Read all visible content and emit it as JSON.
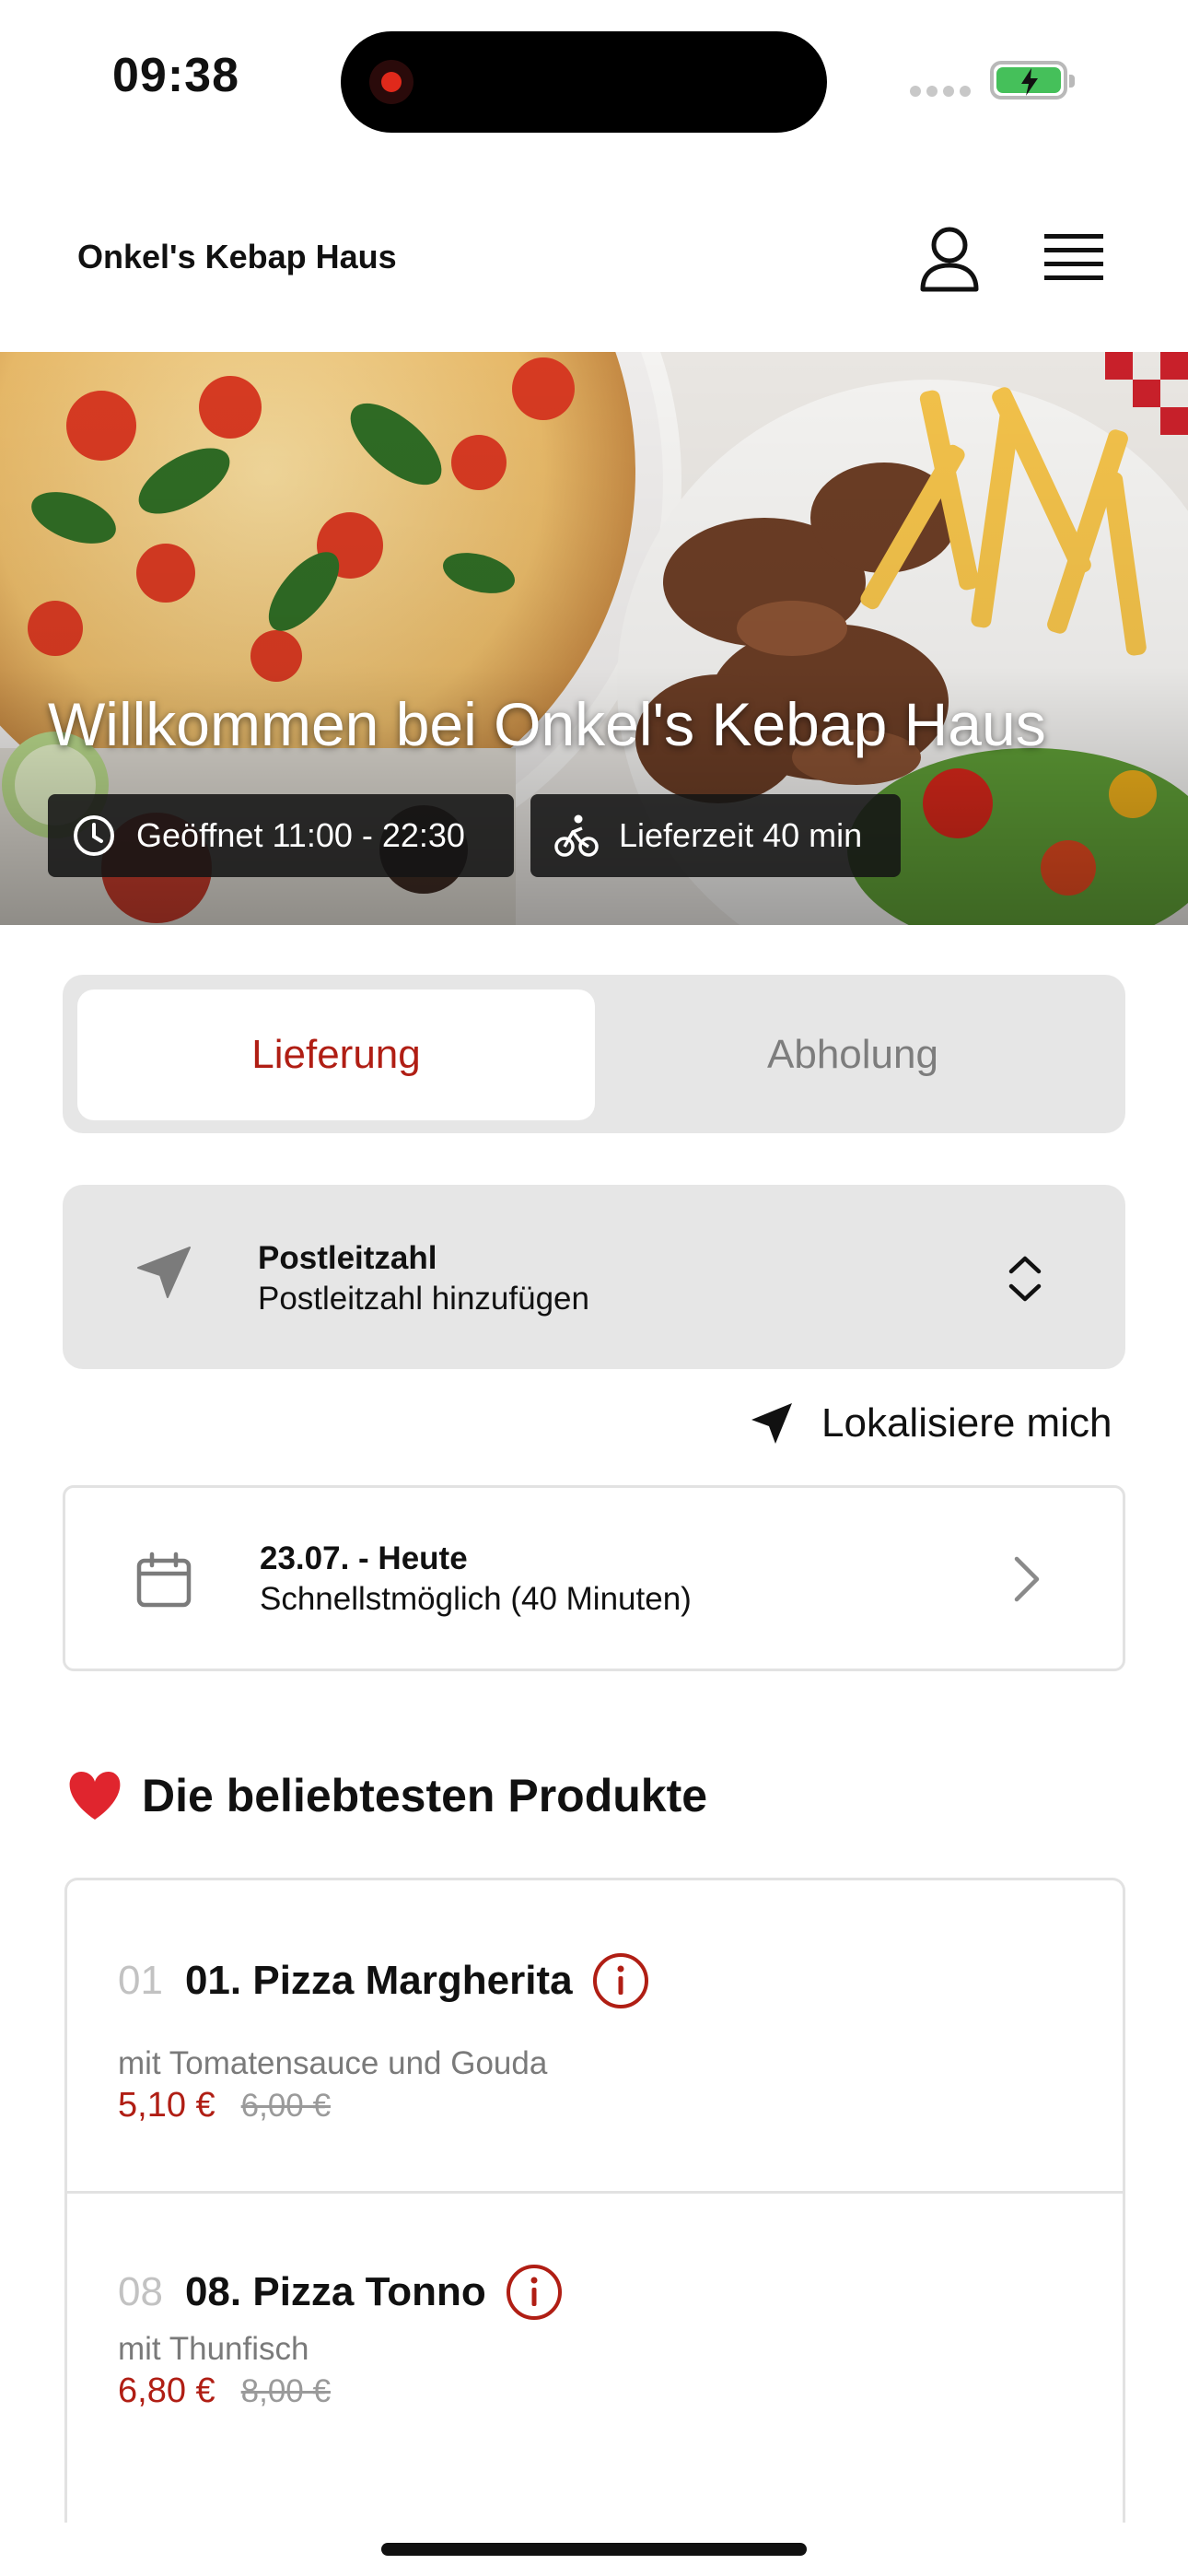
{
  "status_bar": {
    "time": "09:38"
  },
  "header": {
    "brand": "Onkel's Kebap Haus",
    "icons": [
      "user-icon",
      "menu-icon"
    ]
  },
  "hero": {
    "title": "Willkommen bei Onkel's Kebap Haus",
    "opening_hours": "Geöffnet 11:00 - 22:30",
    "delivery_time": "Lieferzeit 40 min"
  },
  "mode_toggle": {
    "delivery": "Lieferung",
    "pickup": "Abholung",
    "selected": "delivery"
  },
  "postcode": {
    "label": "Postleitzahl",
    "placeholder": "Postleitzahl hinzufügen"
  },
  "locate": {
    "label": "Lokalisiere mich"
  },
  "schedule": {
    "title": "23.07. - Heute",
    "subtitle": "Schnellstmöglich (40 Minuten)"
  },
  "popular": {
    "title": "Die beliebtesten Produkte",
    "products": [
      {
        "number": "01",
        "name": "01. Pizza Margherita",
        "description": "mit Tomatensauce und Gouda",
        "price": "5,10 €",
        "old_price": "6,00 €"
      },
      {
        "number": "08",
        "name": "08. Pizza Tonno",
        "description": "mit Thunfisch",
        "price": "6,80 €",
        "old_price": "8,00 €"
      }
    ]
  },
  "colors": {
    "accent": "#b01e14",
    "panel": "#e6e6e6",
    "chip": "#141414"
  }
}
